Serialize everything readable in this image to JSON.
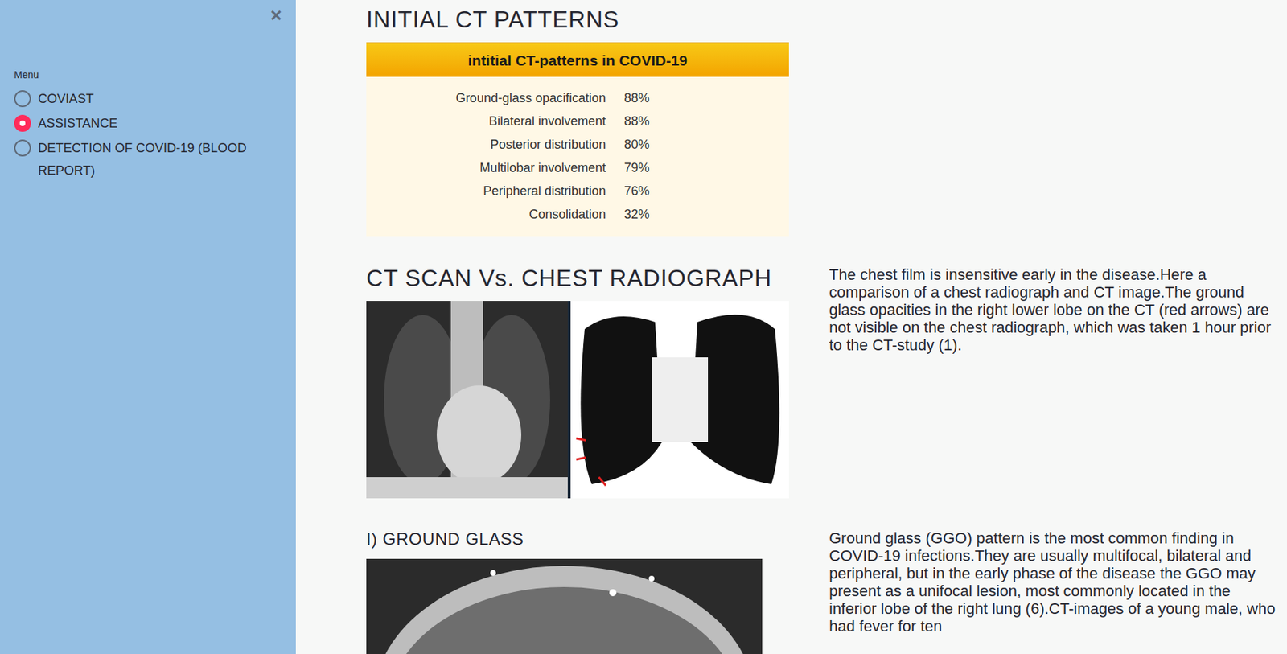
{
  "sidebar": {
    "close": "×",
    "menu_label": "Menu",
    "items": [
      {
        "label": "COVIAST",
        "selected": false
      },
      {
        "label": "ASSISTANCE",
        "selected": true
      },
      {
        "label": "DETECTION OF COVID-19 (BLOOD REPORT)",
        "selected": false
      }
    ]
  },
  "patterns": {
    "heading": "INITIAL CT PATTERNS",
    "table_title": "intitial CT-patterns in COVID-19",
    "rows": [
      {
        "label": "Ground-glass opacification",
        "value": "88%"
      },
      {
        "label": "Bilateral involvement",
        "value": "88%"
      },
      {
        "label": "Posterior distribution",
        "value": "80%"
      },
      {
        "label": "Multilobar involvement",
        "value": "79%"
      },
      {
        "label": "Peripheral distribution",
        "value": "76%"
      },
      {
        "label": "Consolidation",
        "value": "32%"
      }
    ]
  },
  "comparison": {
    "heading": "CT SCAN Vs. CHEST RADIOGRAPH",
    "text": "The chest film is insensitive early in the disease.Here a comparison of a chest radiograph and CT image.The ground glass opacities in the right lower lobe on the CT (red arrows) are not visible on the chest radiograph, which was taken 1 hour prior to the CT-study (1)."
  },
  "ground_glass": {
    "heading": "I) GROUND GLASS",
    "text": "Ground glass (GGO) pattern is the most common finding in COVID-19 infections.They are usually multifocal, bilateral and peripheral, but in the early phase of the disease the GGO may present as a unifocal lesion, most commonly located in the inferior lobe of the right lung (6).CT-images of a young male, who had fever for ten"
  }
}
